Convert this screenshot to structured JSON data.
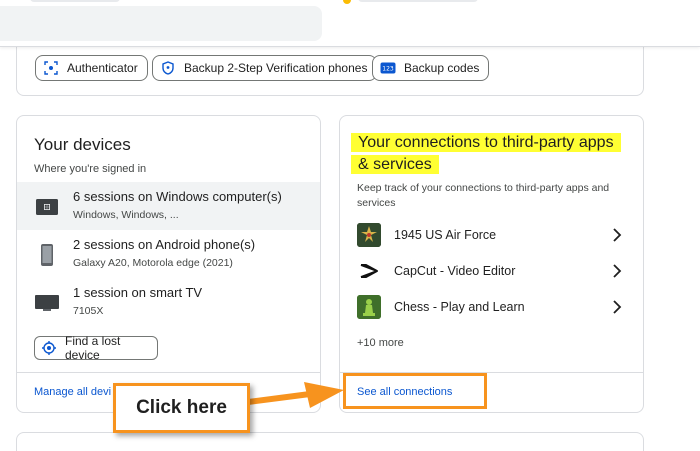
{
  "security_chips": [
    {
      "label": "Authenticator",
      "icon": "authenticator-icon"
    },
    {
      "label": "Backup 2-Step Verification phones",
      "icon": "shield-icon"
    },
    {
      "label": "Backup codes",
      "icon": "backup-codes-icon"
    }
  ],
  "backup_codes_icon_text": "123",
  "devices": {
    "title": "Your devices",
    "subtitle": "Where you're signed in",
    "items": [
      {
        "main": "6 sessions on Windows computer(s)",
        "detail": "Windows, Windows, ...",
        "icon": "laptop-icon"
      },
      {
        "main": "2 sessions on Android phone(s)",
        "detail": "Galaxy A20, Motorola edge (2021)",
        "icon": "phone-icon"
      },
      {
        "main": "1 session on smart TV",
        "detail": "7105X",
        "icon": "tv-icon"
      }
    ],
    "find_button": "Find a lost device",
    "manage_link": "Manage all devi"
  },
  "connections": {
    "title": "Your connections to third-party apps & services",
    "subtitle": "Keep track of your connections to third-party apps and services",
    "apps": [
      {
        "name": "1945 US Air Force",
        "icon": "airforce-game-icon"
      },
      {
        "name": "CapCut - Video Editor",
        "icon": "capcut-icon"
      },
      {
        "name": "Chess - Play and Learn",
        "icon": "chess-icon"
      }
    ],
    "more": "+10 more",
    "see_all_link": "See all connections"
  },
  "callout": {
    "text": "Click here"
  },
  "colors": {
    "link": "#0b57d0",
    "highlight": "#ffff33",
    "annotation": "#f7931e",
    "border": "#dadce0"
  }
}
